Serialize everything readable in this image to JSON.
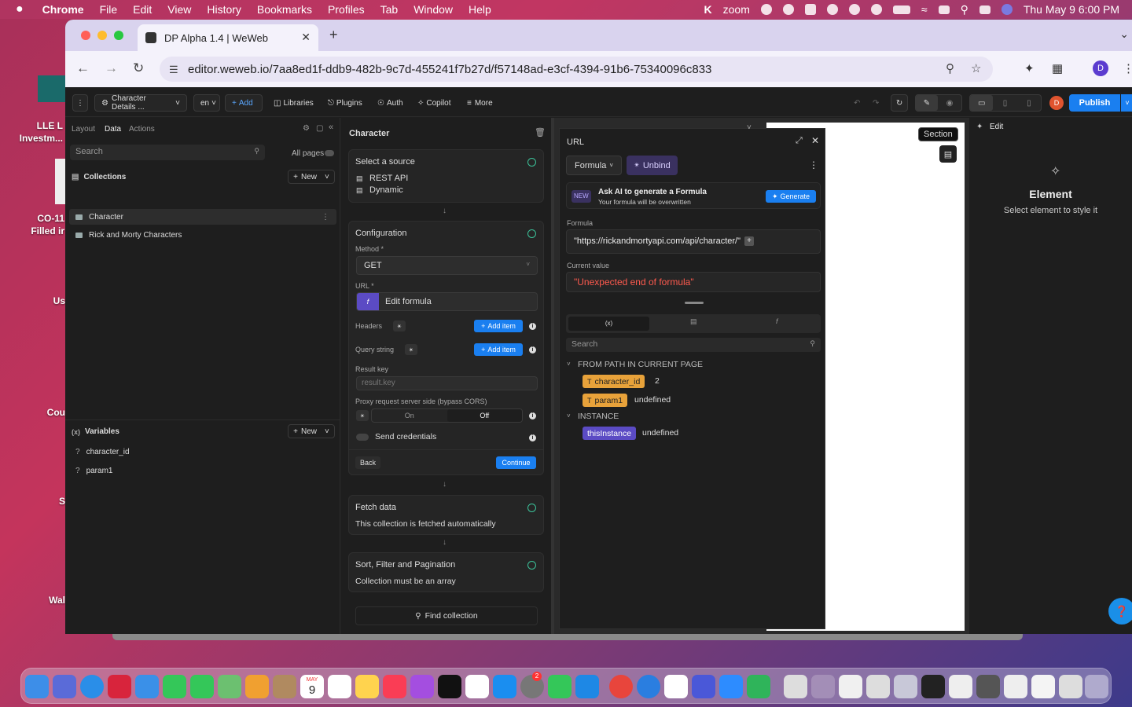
{
  "menubar": {
    "apple": "",
    "items": [
      "Chrome",
      "File",
      "Edit",
      "View",
      "History",
      "Bookmarks",
      "Profiles",
      "Tab",
      "Window",
      "Help"
    ],
    "zoom": "zoom",
    "datetime": "Thu May 9  6:00 PM"
  },
  "desktop": {
    "labels": [
      "LLE L",
      "Investm...",
      "CO-11",
      "Filled ir",
      "Us",
      "Cou",
      "S",
      "Wal"
    ]
  },
  "browser": {
    "tab_title": "DP Alpha 1.4 | WeWeb",
    "url": "editor.weweb.io/7aa8ed1f-ddb9-482b-9c7d-455241f7b27d/f57148ad-e3cf-4394-91b6-75340096c833",
    "profile_initial": "D"
  },
  "toolbar": {
    "page_select": "Character Details ...",
    "lang": "en",
    "add": "Add",
    "libraries": "Libraries",
    "plugins": "Plugins",
    "auth": "Auth",
    "copilot": "Copilot",
    "more": "More",
    "user_initial": "D",
    "publish": "Publish"
  },
  "left": {
    "tabs": [
      "Layout",
      "Data",
      "Actions"
    ],
    "active_tab": "Data",
    "search_placeholder": "Search",
    "all_pages": "All pages",
    "collections_label": "Collections",
    "new_label": "New",
    "collections": [
      "Character",
      "Rick and Morty Characters"
    ],
    "variables_label": "Variables",
    "variables": [
      "character_id",
      "param1"
    ]
  },
  "middle": {
    "title": "Character",
    "source_label": "Select a source",
    "source_rest": "REST API",
    "source_dynamic": "Dynamic",
    "config_label": "Configuration",
    "method_label": "Method *",
    "method_value": "GET",
    "url_label": "URL *",
    "edit_formula": "Edit formula",
    "headers_label": "Headers",
    "query_label": "Query string",
    "add_item": "Add item",
    "result_key_label": "Result key",
    "result_key_placeholder": "result.key",
    "proxy_label": "Proxy request server side (bypass CORS)",
    "proxy_on": "On",
    "proxy_off": "Off",
    "send_credentials": "Send credentials",
    "back": "Back",
    "continue": "Continue",
    "fetch_label": "Fetch data",
    "fetch_desc": "This collection is fetched automatically",
    "sort_label": "Sort, Filter and Pagination",
    "sort_desc": "Collection must be an array",
    "find_collection": "Find collection"
  },
  "popup": {
    "title": "URL",
    "formula_btn": "Formula",
    "unbind_btn": "Unbind",
    "ai_badge": "NEW",
    "ai_title": "Ask AI to generate a Formula",
    "ai_sub": "Your formula will be overwritten",
    "generate": "Generate",
    "formula_label": "Formula",
    "formula_value": "\"https://rickandmortyapi.com/api/character/\"",
    "current_value_label": "Current value",
    "current_value": "\"Unexpected end of formula\"",
    "search_placeholder": "Search",
    "from_path_label": "FROM PATH IN CURRENT PAGE",
    "path_vars": [
      {
        "name": "character_id",
        "value": "2"
      },
      {
        "name": "param1",
        "value": "undefined"
      }
    ],
    "instance_label": "INSTANCE",
    "instance_var": {
      "name": "thisInstance",
      "value": "undefined"
    }
  },
  "canvas": {
    "section_badge": "Section"
  },
  "right": {
    "edit_label": "Edit",
    "element_title": "Element",
    "element_sub": "Select element to style it"
  },
  "dock": {
    "calendar_month": "MAY",
    "calendar_day": "9",
    "badge": "2"
  },
  "colors": {
    "accent_blue": "#1a7ff0",
    "check_green": "#3cc39a",
    "tag_orange": "#e8a23a",
    "tag_purple": "#5b4bc4",
    "error_red": "#ff5a4e",
    "formula_purple": "#5b4bc4"
  }
}
